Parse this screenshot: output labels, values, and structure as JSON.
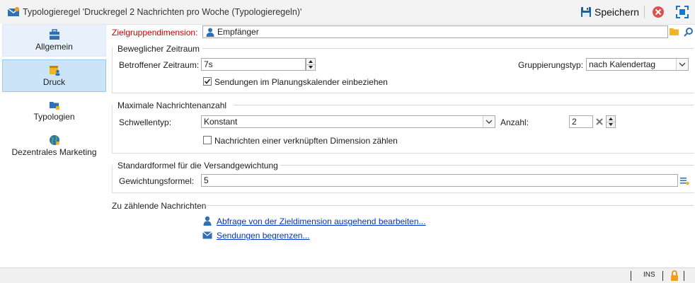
{
  "window": {
    "title": "Typologieregel 'Druckregel 2 Nachrichten pro Woche (Typologieregeln)'"
  },
  "toolbar": {
    "save_label": "Speichern"
  },
  "sidebar": {
    "items": [
      {
        "label": "Allgemein",
        "icon": "briefcase-icon"
      },
      {
        "label": "Druck",
        "icon": "calendar-user-icon"
      },
      {
        "label": "Typologien",
        "icon": "folder-icon"
      },
      {
        "label": "Dezentrales Marketing",
        "icon": "globe-icon"
      }
    ]
  },
  "target": {
    "label": "Zielgruppendimension:",
    "value": "Empfänger"
  },
  "period": {
    "title": "Beweglicher Zeitraum",
    "affected_label": "Betroffener Zeitraum:",
    "affected_value": "7s",
    "grouping_label": "Gruppierungstyp:",
    "grouping_value": "nach Kalendertag",
    "include_checkbox_label": "Sendungen im Planungskalender einbeziehen",
    "include_checked": true
  },
  "maxmsg": {
    "title": "Maximale Nachrichtenanzahl",
    "threshold_label": "Schwellentyp:",
    "threshold_value": "Konstant",
    "count_label": "Anzahl:",
    "count_value": "2",
    "linked_checkbox_label": "Nachrichten einer verknüpften Dimension zählen",
    "linked_checked": false
  },
  "formula": {
    "title": "Standardformel für die Versandgewichtung",
    "weight_label": "Gewichtungsformel:",
    "weight_value": "5"
  },
  "counting": {
    "title": "Zu zählende Nachrichten",
    "link_query": "Abfrage von der Zieldimension ausgehend bearbeiten...",
    "link_limit": "Sendungen begrenzen..."
  },
  "status": {
    "ins": "INS"
  },
  "colors": {
    "accent": "#1a73c8",
    "selected_bg": "#cce4f7",
    "required_label": "#cc0000",
    "link": "#0033cc"
  }
}
